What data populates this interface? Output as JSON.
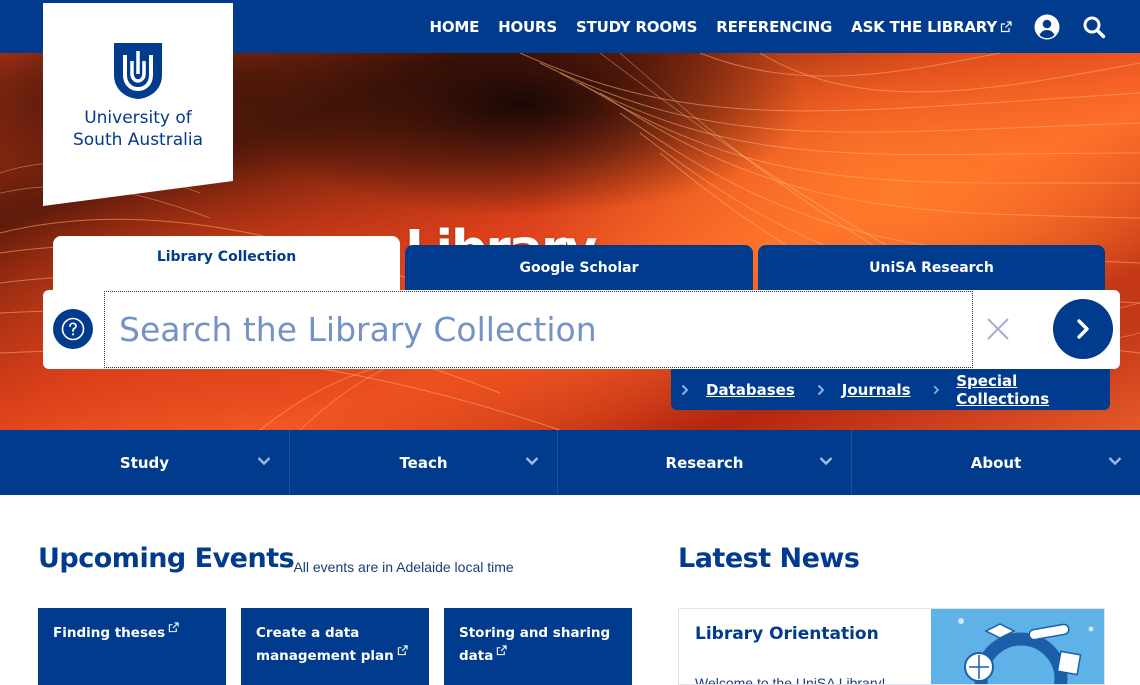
{
  "topnav": {
    "items": [
      {
        "label": "HOME"
      },
      {
        "label": "HOURS"
      },
      {
        "label": "STUDY ROOMS"
      },
      {
        "label": "REFERENCING"
      },
      {
        "label": "ASK THE LIBRARY"
      }
    ],
    "icons": [
      "external-link-icon",
      "user-account-icon",
      "search-icon"
    ]
  },
  "logo": {
    "line1": "University of",
    "line2": "South Australia"
  },
  "hero": {
    "title": "Library"
  },
  "search": {
    "tabs": [
      "Library Collection",
      "Google Scholar",
      "UniSA Research"
    ],
    "placeholder": "Search the Library Collection",
    "icons": [
      "help-icon",
      "close-icon",
      "chevron-right-icon"
    ]
  },
  "quicklinks": [
    {
      "label": "Databases"
    },
    {
      "label": "Journals"
    },
    {
      "label": "Special Collections"
    }
  ],
  "mainnav": [
    {
      "label": "Study"
    },
    {
      "label": "Teach"
    },
    {
      "label": "Research"
    },
    {
      "label": "About"
    }
  ],
  "events": {
    "heading": "Upcoming Events",
    "note": "*All events are in Adelaide local time",
    "cards": [
      {
        "line1": "Finding theses",
        "line2": ""
      },
      {
        "line1": "Create a data",
        "line2": "management plan"
      },
      {
        "line1": "Storing and sharing",
        "line2": "data"
      }
    ]
  },
  "news": {
    "heading": "Latest News",
    "card": {
      "title": "Library Orientation",
      "body": "Welcome to the UniSA Library!"
    }
  },
  "colors": {
    "brand_blue": "#003b8e",
    "hero_orange": "#e8481e",
    "white": "#ffffff"
  }
}
